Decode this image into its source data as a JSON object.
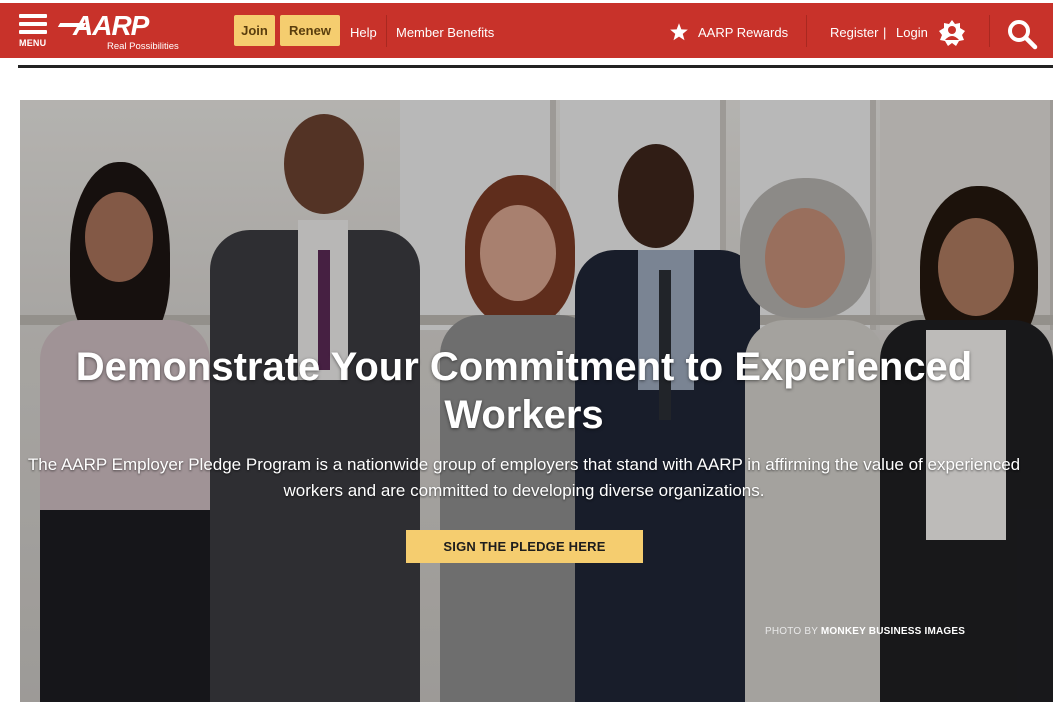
{
  "header": {
    "menu_label": "MENU",
    "logo_text": "AARP",
    "logo_tagline": "Real Possibilities",
    "join_label": "Join",
    "renew_label": "Renew",
    "help_label": "Help",
    "member_benefits_label": "Member Benefits",
    "rewards_label": "AARP Rewards",
    "register_label": "Register",
    "login_label": "Login",
    "brand_color": "#c8322a",
    "button_color": "#f5cd6f",
    "icons": [
      "hamburger-menu-icon",
      "star-icon",
      "login-gear-icon",
      "search-icon"
    ]
  },
  "hero": {
    "title": "Demonstrate Your Commitment to Experienced Workers",
    "description": "The AARP Employer Pledge Program is a nationwide group of employers that stand with AARP in affirming the value of experienced workers and are committed to developing diverse organizations.",
    "cta_label": "SIGN THE PLEDGE HERE",
    "photo_credit_prefix": "PHOTO BY",
    "photo_credit_name": "MONKEY BUSINESS IMAGES"
  }
}
